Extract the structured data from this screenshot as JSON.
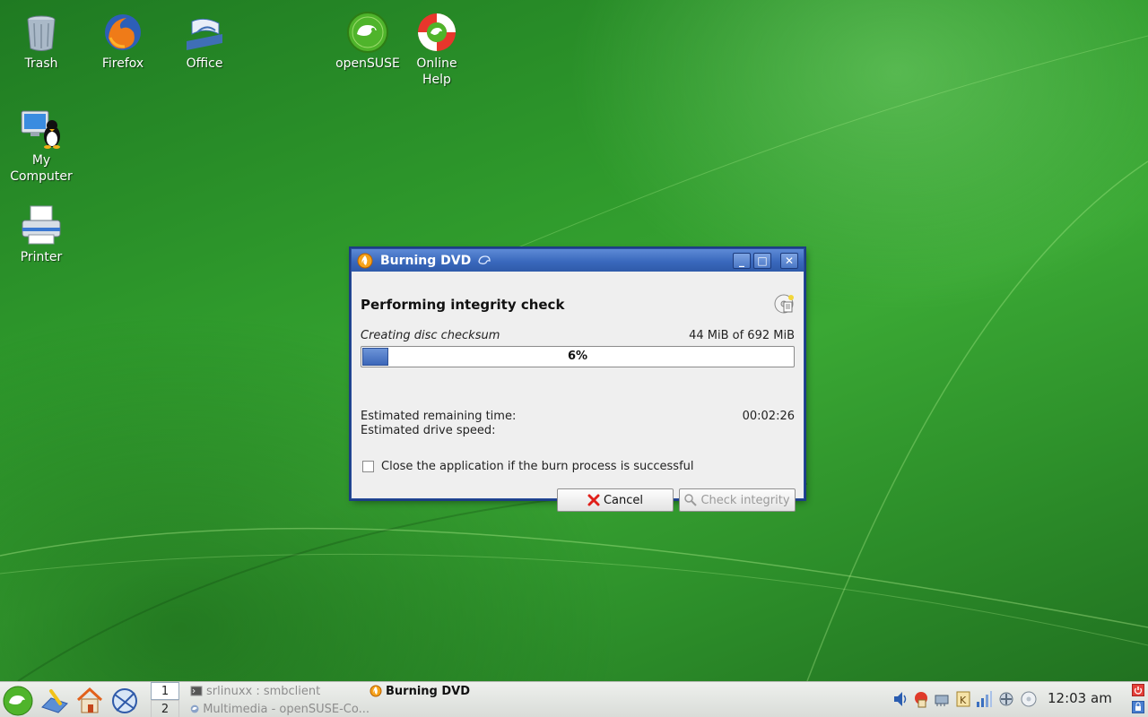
{
  "desktop": {
    "icons": [
      {
        "label": "Trash"
      },
      {
        "label": "Firefox"
      },
      {
        "label": "Office"
      },
      {
        "label": "openSUSE"
      },
      {
        "label": "Online Help"
      },
      {
        "label": "My Computer"
      },
      {
        "label": "Printer"
      }
    ]
  },
  "dialog": {
    "title": "Burning DVD",
    "heading": "Performing integrity check",
    "subtask": "Creating disc checksum",
    "size_progress": "44 MiB of 692 MiB",
    "progress_percent": 6,
    "progress_text": "6%",
    "remaining_label": "Estimated remaining time:",
    "remaining_value": "00:02:26",
    "speed_label": "Estimated drive speed:",
    "speed_value": "",
    "close_checkbox_label": "Close the application if the burn process is successful",
    "close_checkbox_checked": false,
    "cancel_label": "Cancel",
    "check_label": "Check integrity"
  },
  "taskbar": {
    "pager": [
      "1",
      "2"
    ],
    "tasks": [
      {
        "label": "srlinuxx : smbclient"
      },
      {
        "label": "Burning DVD"
      },
      {
        "label": "Multimedia - openSUSE-Co..."
      }
    ],
    "clock": "12:03 am"
  },
  "colors": {
    "titlebar": "#3a69bd",
    "desktop_green": "#2f9a2c",
    "progress_fill": "#4a74c2"
  }
}
